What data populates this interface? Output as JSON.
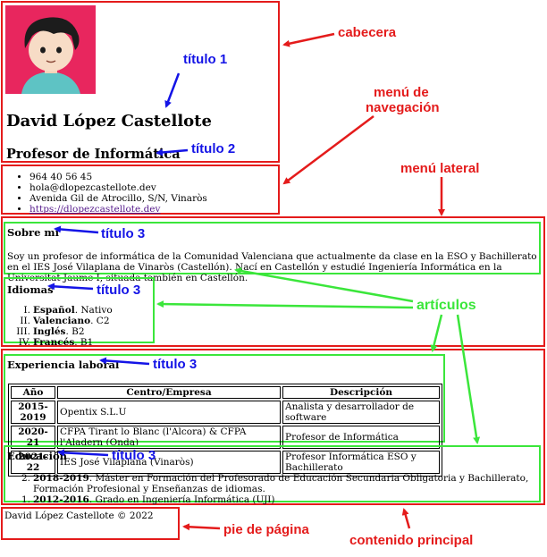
{
  "header": {
    "name": "David López Castellote",
    "subtitle": "Profesor de Informática",
    "avatar_icon": "avatar-illustration"
  },
  "nav": {
    "items": [
      {
        "text": "964 40 56 45"
      },
      {
        "text": "hola@dlopezcastellote.dev"
      },
      {
        "text": "Avenida Gil de Atrocillo, S/N, Vinaròs"
      },
      {
        "text": "https://dlopezcastellote.dev"
      }
    ]
  },
  "aside": {
    "about": {
      "title": "Sobre mí",
      "text": "Soy un profesor de informática de la Comunidad Valenciana que actualmente da clase en la ESO y Bachillerato en el IES José Vilaplana de Vinaròs (Castellón). Nací en Castellón y estudié Ingeniería Informática en la Universitat Jaume I, situada también en Castellón."
    },
    "languages": {
      "title": "Idiomas",
      "items": [
        {
          "num": "I.",
          "lang": "Español",
          "level": ". Nativo"
        },
        {
          "num": "II.",
          "lang": "Valenciano",
          "level": ". C2"
        },
        {
          "num": "III.",
          "lang": "Inglés",
          "level": ". B2"
        },
        {
          "num": "IV.",
          "lang": "Francés",
          "level": ". B1"
        }
      ]
    }
  },
  "main": {
    "experience": {
      "title": "Experiencia laboral",
      "headers": [
        "Año",
        "Centro/Empresa",
        "Descripción"
      ],
      "rows": [
        [
          "2015-2019",
          "Opentix S.L.U",
          "Analista y desarrollador de software"
        ],
        [
          "2020-21",
          "CFPA Tirant lo Blanc (l'Alcora) & CFPA l'Aladern (Onda)",
          "Profesor de Informática"
        ],
        [
          "2021-22",
          "IES José Vilaplana (Vinaròs)",
          "Profesor Informática ESO y Bachillerato"
        ]
      ]
    },
    "education": {
      "title": "Educación",
      "items": [
        {
          "num": "2.",
          "year": "2018-2019",
          "text": ". Máster en Formación del Profesorado de Educación Secundaria Obligatoria y Bachillerato, Formación Profesional y Enseñanzas de idiomas."
        },
        {
          "num": "1.",
          "year": "2012-2016",
          "text": ". Grado en Ingeniería Informática (UJI)"
        }
      ]
    }
  },
  "footer": {
    "text": "David López Castellote © 2022"
  },
  "annotations": {
    "cabecera": "cabecera",
    "menu_nav_1": "menú de",
    "menu_nav_2": "navegación",
    "menu_lateral": "menú lateral",
    "articulos": "artículos",
    "pie": "pie de página",
    "contenido": "contenido principal",
    "titulo1": "título 1",
    "titulo2": "título 2",
    "titulo3": "título 3"
  },
  "colors": {
    "red": "#e41b1b",
    "green": "#3be63b",
    "blue": "#1414e6",
    "avatar_bg": "#e8265e"
  }
}
